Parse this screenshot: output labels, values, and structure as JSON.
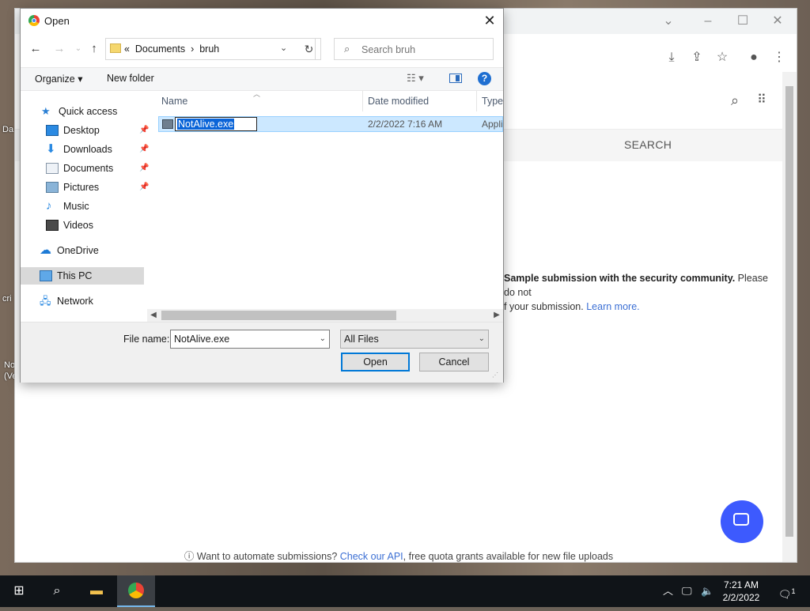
{
  "desktop": {
    "labels": [
      "Da",
      "cri",
      "No",
      "(Ve"
    ]
  },
  "browser": {
    "page": {
      "search_tab": "SEARCH",
      "sample_bold": "Sample submission with the security community.",
      "sample_rest": " Please do not",
      "sample_line2_pre": "f your submission. ",
      "learn_more": "Learn more.",
      "footer_pre": "Want to automate submissions? ",
      "footer_link": "Check our API",
      "footer_post": ", free quota grants available for new file uploads"
    }
  },
  "dialog": {
    "title": "Open",
    "address": {
      "prefix": "«",
      "crumb1": "Documents",
      "sep": "›",
      "crumb2": "bruh"
    },
    "search_placeholder": "Search bruh",
    "commands": {
      "organize": "Organize ▾",
      "new_folder": "New folder"
    },
    "nav": [
      {
        "label": "Quick access"
      },
      {
        "label": "Desktop",
        "pinned": true
      },
      {
        "label": "Downloads",
        "pinned": true
      },
      {
        "label": "Documents",
        "pinned": true
      },
      {
        "label": "Pictures",
        "pinned": true
      },
      {
        "label": "Music"
      },
      {
        "label": "Videos"
      },
      {
        "label": "OneDrive"
      },
      {
        "label": "This PC",
        "selected": true
      },
      {
        "label": "Network"
      }
    ],
    "columns": {
      "name": "Name",
      "date": "Date modified",
      "type": "Type"
    },
    "files": [
      {
        "name": "NotAlive.exe",
        "date": "2/2/2022 7:16 AM",
        "type": "Appli"
      }
    ],
    "file_name_label": "File name:",
    "file_name_value": "NotAlive.exe",
    "file_type": "All Files",
    "open_label": "Open",
    "cancel_label": "Cancel"
  },
  "taskbar": {
    "time": "7:21 AM",
    "date": "2/2/2022",
    "notification_count": "1"
  },
  "colors": {
    "accent": "#0078d7",
    "selection": "#cce8ff",
    "fab": "#3d5afe",
    "link": "#3b6fd4"
  }
}
